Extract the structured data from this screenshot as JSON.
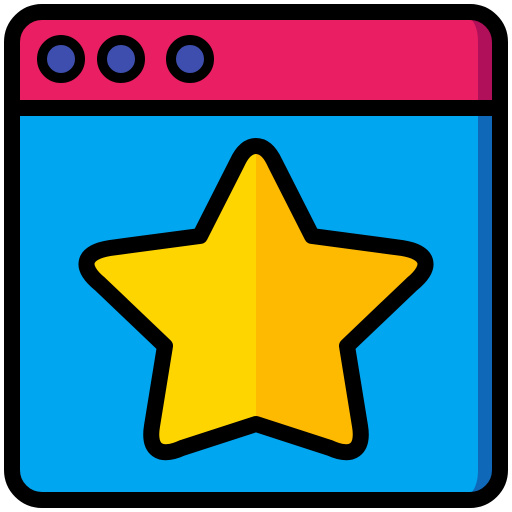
{
  "icon": {
    "name": "browser-window-star-icon",
    "colors": {
      "outline": "#000000",
      "titlebar": "#E91E63",
      "titlebar_shade": "#B0105A",
      "content": "#00A6F0",
      "content_shade": "#1068B8",
      "dot": "#3D4EAE",
      "star_left": "#FFD500",
      "star_right": "#FDBA00"
    }
  }
}
